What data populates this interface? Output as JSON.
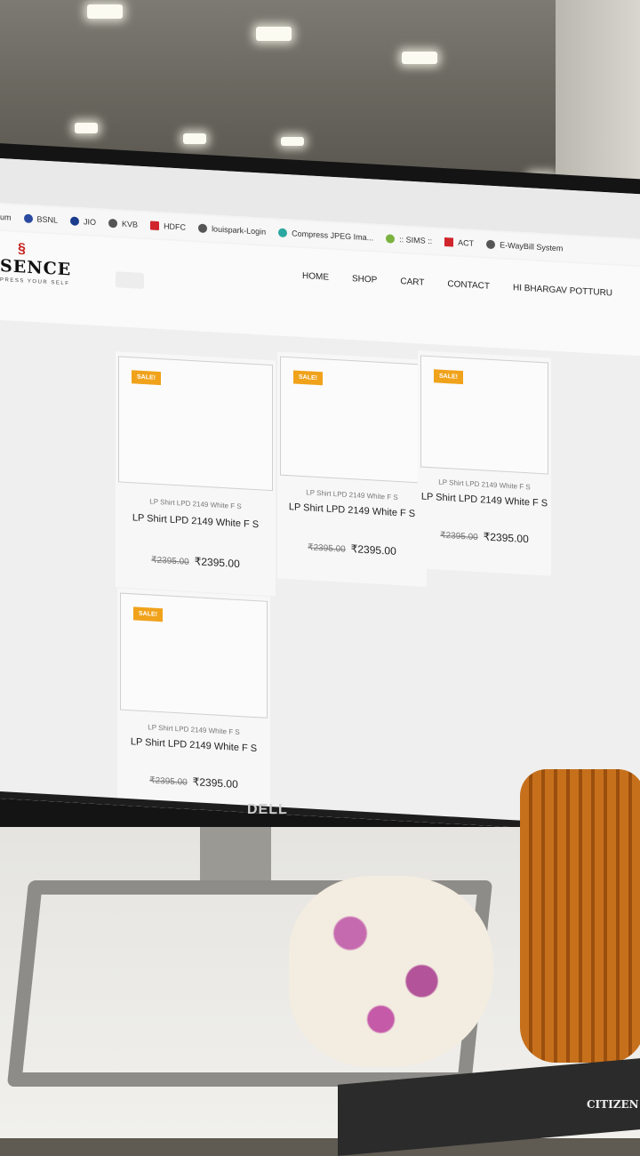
{
  "bookmarks": [
    "um",
    "BSNL",
    "JIO",
    "KVB",
    "HDFC",
    "louispark-Login",
    "Compress JPEG Ima...",
    ":: SIMS ::",
    "ACT",
    "E-WayBill System"
  ],
  "site": {
    "logo_text": "SENCE",
    "logo_tagline": "PRESS YOUR SELF",
    "nav": [
      "HOME",
      "SHOP",
      "CART",
      "CONTACT",
      "HI BHARGAV POTTURU"
    ]
  },
  "products": [
    {
      "badge": "SALE!",
      "category": "LP Shirt LPD 2149 White F S",
      "name": "LP Shirt LPD 2149 White F S",
      "old_price": "₹2395.00",
      "price": "₹2395.00"
    },
    {
      "badge": "SALE!",
      "category": "LP Shirt LPD 2149 White F S",
      "name": "LP Shirt LPD 2149 White F S",
      "old_price": "₹2395.00",
      "price": "₹2395.00"
    },
    {
      "badge": "SALE!",
      "category": "LP Shirt LPD 2149 White F S",
      "name": "LP Shirt LPD 2149 White F S",
      "old_price": "₹2395.00",
      "price": "₹2395.00"
    },
    {
      "badge": "SALE!",
      "category": "LP Shirt LPD 2149 White F S",
      "name": "LP Shirt LPD 2149 White F S",
      "old_price": "₹2395.00",
      "price": "₹2395.00"
    }
  ],
  "monitor_brand": "DELL",
  "calculator_brand": "CITIZEN",
  "colors": {
    "sale_badge": "#f0a21b",
    "logo_red": "#c8201c"
  }
}
